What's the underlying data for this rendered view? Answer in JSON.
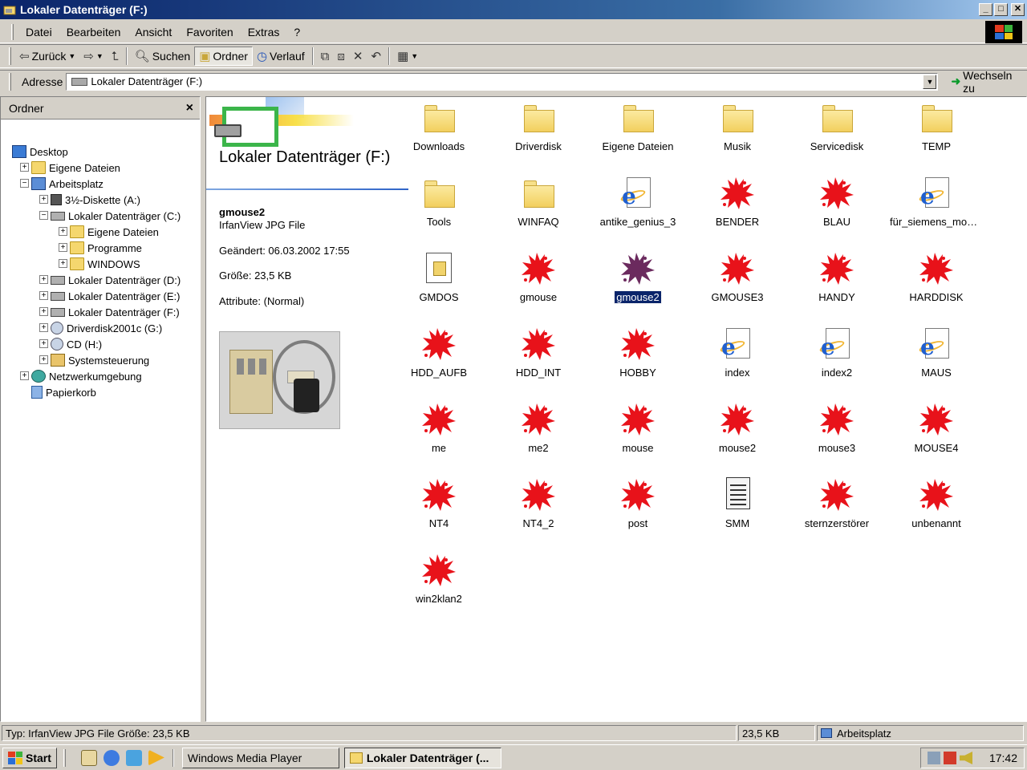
{
  "window": {
    "title": "Lokaler Datenträger (F:)",
    "btn_min": "_",
    "btn_max": "□",
    "btn_close": "✕"
  },
  "menu": [
    "Datei",
    "Bearbeiten",
    "Ansicht",
    "Favoriten",
    "Extras",
    "?"
  ],
  "toolbar": {
    "back": "Zurück",
    "search": "Suchen",
    "folders": "Ordner",
    "history": "Verlauf"
  },
  "address": {
    "label": "Adresse",
    "value": "Lokaler Datenträger (F:)",
    "go": "Wechseln zu"
  },
  "folder_pane": {
    "title": "Ordner",
    "items": [
      {
        "label": "Desktop",
        "icon": "desktop-icon",
        "depth": 0,
        "expander": ""
      },
      {
        "label": "Eigene Dateien",
        "icon": "folder-icon",
        "depth": 1,
        "expander": "+"
      },
      {
        "label": "Arbeitsplatz",
        "icon": "computer-icon",
        "depth": 1,
        "expander": "−"
      },
      {
        "label": "3½-Diskette (A:)",
        "icon": "floppy-icon",
        "depth": 2,
        "expander": "+"
      },
      {
        "label": "Lokaler Datenträger (C:)",
        "icon": "drive-icon",
        "depth": 2,
        "expander": "−"
      },
      {
        "label": "Eigene Dateien",
        "icon": "folder-icon",
        "depth": 3,
        "expander": "+"
      },
      {
        "label": "Programme",
        "icon": "folder-icon",
        "depth": 3,
        "expander": "+"
      },
      {
        "label": "WINDOWS",
        "icon": "folder-icon",
        "depth": 3,
        "expander": "+"
      },
      {
        "label": "Lokaler Datenträger (D:)",
        "icon": "drive-icon",
        "depth": 2,
        "expander": "+"
      },
      {
        "label": "Lokaler Datenträger (E:)",
        "icon": "drive-icon",
        "depth": 2,
        "expander": "+"
      },
      {
        "label": "Lokaler Datenträger (F:)",
        "icon": "drive-icon",
        "depth": 2,
        "expander": "+"
      },
      {
        "label": "Driverdisk2001c (G:)",
        "icon": "cd-icon",
        "depth": 2,
        "expander": "+"
      },
      {
        "label": "CD (H:)",
        "icon": "cd-icon",
        "depth": 2,
        "expander": "+"
      },
      {
        "label": "Systemsteuerung",
        "icon": "control-panel-icon",
        "depth": 2,
        "expander": "+"
      },
      {
        "label": "Netzwerkumgebung",
        "icon": "network-icon",
        "depth": 1,
        "expander": "+"
      },
      {
        "label": "Papierkorb",
        "icon": "recycle-bin-icon",
        "depth": 1,
        "expander": ""
      }
    ]
  },
  "webview": {
    "title": "Lokaler Datenträger (F:)",
    "file_name": "gmouse2",
    "file_type": "IrfanView JPG File",
    "modified": "Geändert: 06.03.2002 17:55",
    "size": "Größe: 23,5 KB",
    "attributes": "Attribute: (Normal)"
  },
  "files": [
    {
      "name": "Downloads",
      "type": "folder"
    },
    {
      "name": "Driverdisk",
      "type": "folder"
    },
    {
      "name": "Eigene Dateien",
      "type": "folder"
    },
    {
      "name": "Musik",
      "type": "folder"
    },
    {
      "name": "Servicedisk",
      "type": "folder"
    },
    {
      "name": "TEMP",
      "type": "folder"
    },
    {
      "name": "Tools",
      "type": "folder"
    },
    {
      "name": "WINFAQ",
      "type": "folder"
    },
    {
      "name": "antike_genius_3",
      "type": "html"
    },
    {
      "name": "BENDER",
      "type": "jpg"
    },
    {
      "name": "BLAU",
      "type": "jpg"
    },
    {
      "name": "für_siemens_mobil...",
      "type": "html"
    },
    {
      "name": "GMDOS",
      "type": "exe"
    },
    {
      "name": "gmouse",
      "type": "jpg"
    },
    {
      "name": "gmouse2",
      "type": "jpg",
      "selected": true
    },
    {
      "name": "GMOUSE3",
      "type": "jpg"
    },
    {
      "name": "HANDY",
      "type": "jpg"
    },
    {
      "name": "HARDDISK",
      "type": "jpg"
    },
    {
      "name": "HDD_AUFB",
      "type": "jpg"
    },
    {
      "name": "HDD_INT",
      "type": "jpg"
    },
    {
      "name": "HOBBY",
      "type": "jpg"
    },
    {
      "name": "index",
      "type": "html"
    },
    {
      "name": "index2",
      "type": "html"
    },
    {
      "name": "MAUS",
      "type": "html"
    },
    {
      "name": "me",
      "type": "jpg"
    },
    {
      "name": "me2",
      "type": "jpg"
    },
    {
      "name": "mouse",
      "type": "jpg"
    },
    {
      "name": "mouse2",
      "type": "jpg"
    },
    {
      "name": "mouse3",
      "type": "jpg"
    },
    {
      "name": "MOUSE4",
      "type": "jpg"
    },
    {
      "name": "NT4",
      "type": "jpg"
    },
    {
      "name": "NT4_2",
      "type": "jpg"
    },
    {
      "name": "post",
      "type": "jpg"
    },
    {
      "name": "SMM",
      "type": "txt"
    },
    {
      "name": "sternzerstörer",
      "type": "jpg"
    },
    {
      "name": "unbenannt",
      "type": "jpg"
    },
    {
      "name": "win2klan2",
      "type": "jpg"
    }
  ],
  "statusbar": {
    "info": "Typ: IrfanView JPG File Größe: 23,5 KB",
    "size": "23,5 KB",
    "zone": "Arbeitsplatz"
  },
  "taskbar": {
    "start": "Start",
    "tasks": [
      {
        "label": "Windows Media Player",
        "active": false
      },
      {
        "label": "Lokaler Datenträger (...",
        "active": true
      }
    ],
    "time": "17:42"
  },
  "colors": {
    "jpg_icon": "#e8121a",
    "jpg_icon_selected": "#6b2a5e",
    "selection": "#0a246a",
    "titlebar": "#0a246a"
  }
}
